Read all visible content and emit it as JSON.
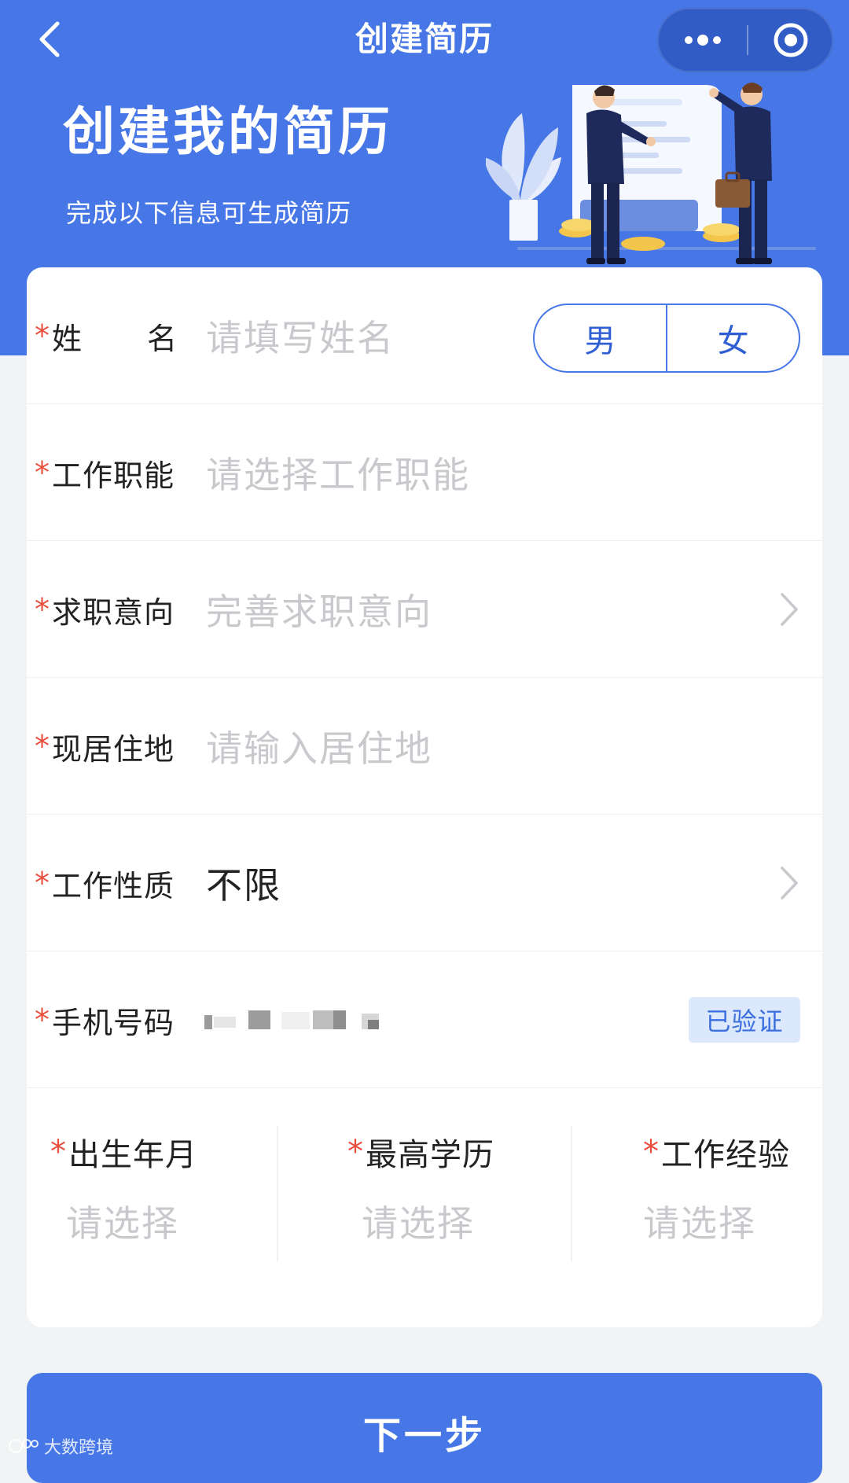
{
  "colors": {
    "brand_blue": "#4777e6",
    "required_star": "#e84d3d",
    "placeholder": "#c8c9cc",
    "verified_bg": "#dce8fb"
  },
  "nav": {
    "title": "创建简历",
    "icons": [
      "back-chevron-icon",
      "more-dots-icon",
      "target-circle-icon"
    ]
  },
  "hero": {
    "title": "创建我的简历",
    "subtitle": "完成以下信息可生成简历",
    "illustration": "two-businessmen-resume-illustration"
  },
  "form": {
    "required_mark": "*",
    "name": {
      "label_a": "姓",
      "label_b": "名",
      "placeholder": "请填写姓名",
      "gender_options": [
        "男",
        "女"
      ]
    },
    "function": {
      "label": "工作职能",
      "placeholder": "请选择工作职能"
    },
    "intention": {
      "label": "求职意向",
      "placeholder": "完善求职意向"
    },
    "residence": {
      "label": "现居住地",
      "placeholder": "请输入居住地"
    },
    "nature": {
      "label": "工作性质",
      "value": "不限"
    },
    "phone": {
      "label": "手机号码",
      "badge": "已验证"
    },
    "birth": {
      "label": "出生年月",
      "placeholder": "请选择"
    },
    "education": {
      "label": "最高学历",
      "placeholder": "请选择"
    },
    "experience": {
      "label": "工作经验",
      "placeholder": "请选择"
    }
  },
  "footer": {
    "next_label": "下一步",
    "watermark": "大数跨境"
  }
}
